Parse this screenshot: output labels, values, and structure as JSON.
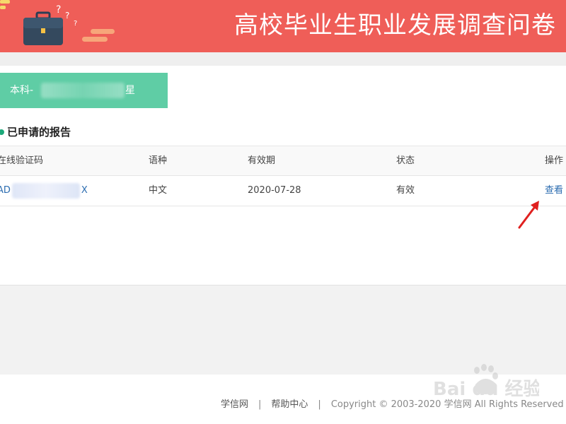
{
  "banner": {
    "title": "高校毕业生职业发展调查问卷",
    "icon": "briefcase-icon"
  },
  "certificate": {
    "prefix": "本科-",
    "suffix": "星"
  },
  "section": {
    "title": "已申请的报告"
  },
  "table": {
    "headers": [
      "在线验证码",
      "语种",
      "有效期",
      "状态",
      "操作"
    ],
    "rows": [
      {
        "code_prefix": "AD",
        "code_suffix": "X",
        "language": "中文",
        "expiry": "2020-07-28",
        "status": "有效",
        "action": "查看"
      }
    ]
  },
  "footer": {
    "link1": "学信网",
    "link2": "帮助中心",
    "separator": "|",
    "copyright": "Copyright © 2003-2020 学信网 All Rights Reserved"
  },
  "watermark": {
    "text": "Bai du 经验"
  },
  "colors": {
    "banner": "#ef5e58",
    "badge": "#5fcda5",
    "link": "#2b6cb0",
    "arrow": "#e0201f"
  }
}
